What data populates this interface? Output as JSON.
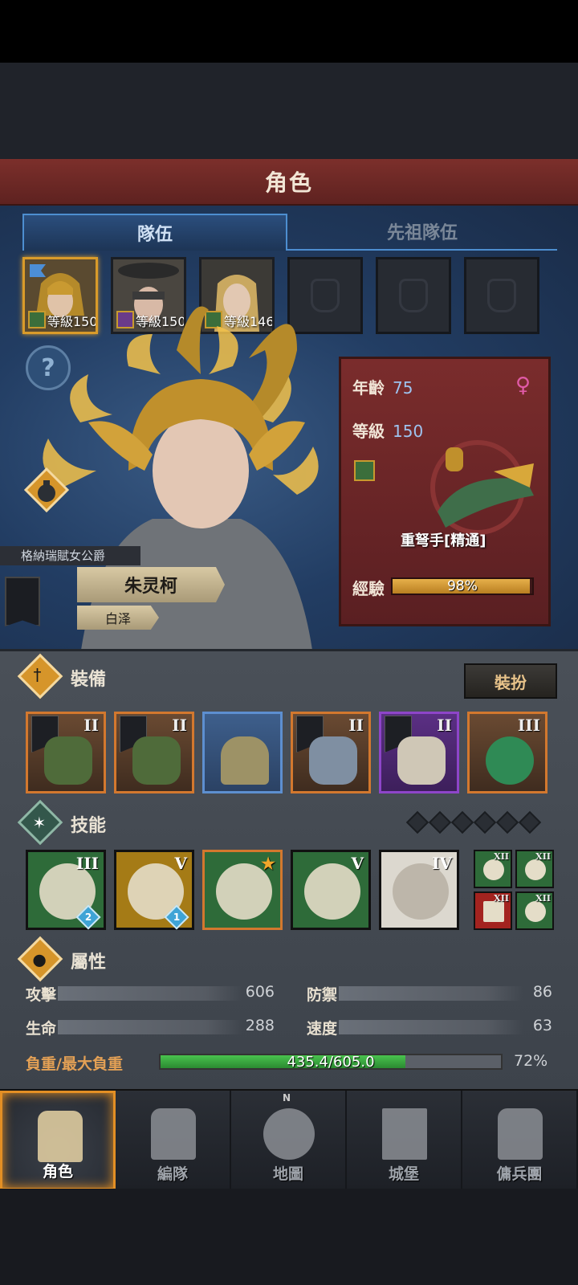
{
  "title": "角色",
  "tabs": [
    {
      "label": "隊伍",
      "active": true
    },
    {
      "label": "先祖隊伍",
      "active": false
    }
  ],
  "roster": [
    {
      "level_text": "等級150",
      "selected": true
    },
    {
      "level_text": "等級150",
      "selected": false
    },
    {
      "level_text": "等級146",
      "selected": false
    }
  ],
  "help_icon": "?",
  "info_card": {
    "age_label": "年齡",
    "age_value": "75",
    "level_label": "等級",
    "level_value": "150",
    "gender_icon": "♀",
    "class_name": "重弩手[精通]",
    "exp_label": "經驗",
    "exp_text": "98%",
    "exp_fraction": 0.98
  },
  "character": {
    "title": "格納瑞賦女公爵",
    "name": "朱灵柯",
    "subname": "白泽"
  },
  "equipment": {
    "section_title": "裝備",
    "dress_button": "裝扮",
    "items": [
      {
        "rank": "II",
        "rarity": "orange"
      },
      {
        "rank": "II",
        "rarity": "orange"
      },
      {
        "rank": "",
        "rarity": "blue"
      },
      {
        "rank": "II",
        "rarity": "orange"
      },
      {
        "rank": "II",
        "rarity": "purple"
      },
      {
        "rank": "III",
        "rarity": "orange"
      }
    ]
  },
  "skills": {
    "section_title": "技能",
    "slots_total": 6,
    "items": [
      {
        "rank": "III",
        "badge": "2"
      },
      {
        "rank": "V",
        "badge": "1"
      },
      {
        "rank": "",
        "badge": ""
      },
      {
        "rank": "V",
        "badge": ""
      },
      {
        "rank": "IV",
        "badge": ""
      }
    ],
    "mini": [
      {
        "rank": "XII"
      },
      {
        "rank": "XII"
      },
      {
        "rank": "XII"
      },
      {
        "rank": "XII"
      }
    ]
  },
  "attributes": {
    "section_title": "屬性",
    "attack_label": "攻擊",
    "attack_value": "606",
    "defense_label": "防禦",
    "defense_value": "86",
    "hp_label": "生命",
    "hp_value": "288",
    "speed_label": "速度",
    "speed_value": "63",
    "load_label": "負重/最大負重",
    "load_text": "435.4/605.0",
    "load_pct": "72%",
    "load_fraction": 0.72
  },
  "nav": [
    {
      "label": "角色",
      "active": true
    },
    {
      "label": "編隊",
      "active": false
    },
    {
      "label": "地圖",
      "active": false
    },
    {
      "label": "城堡",
      "active": false
    },
    {
      "label": "傭兵團",
      "active": false
    }
  ],
  "compass_letter": "N",
  "colors": {
    "accent": "#e38f24",
    "title_bar": "#7c2f2b",
    "panel_blue": "#223d63"
  }
}
